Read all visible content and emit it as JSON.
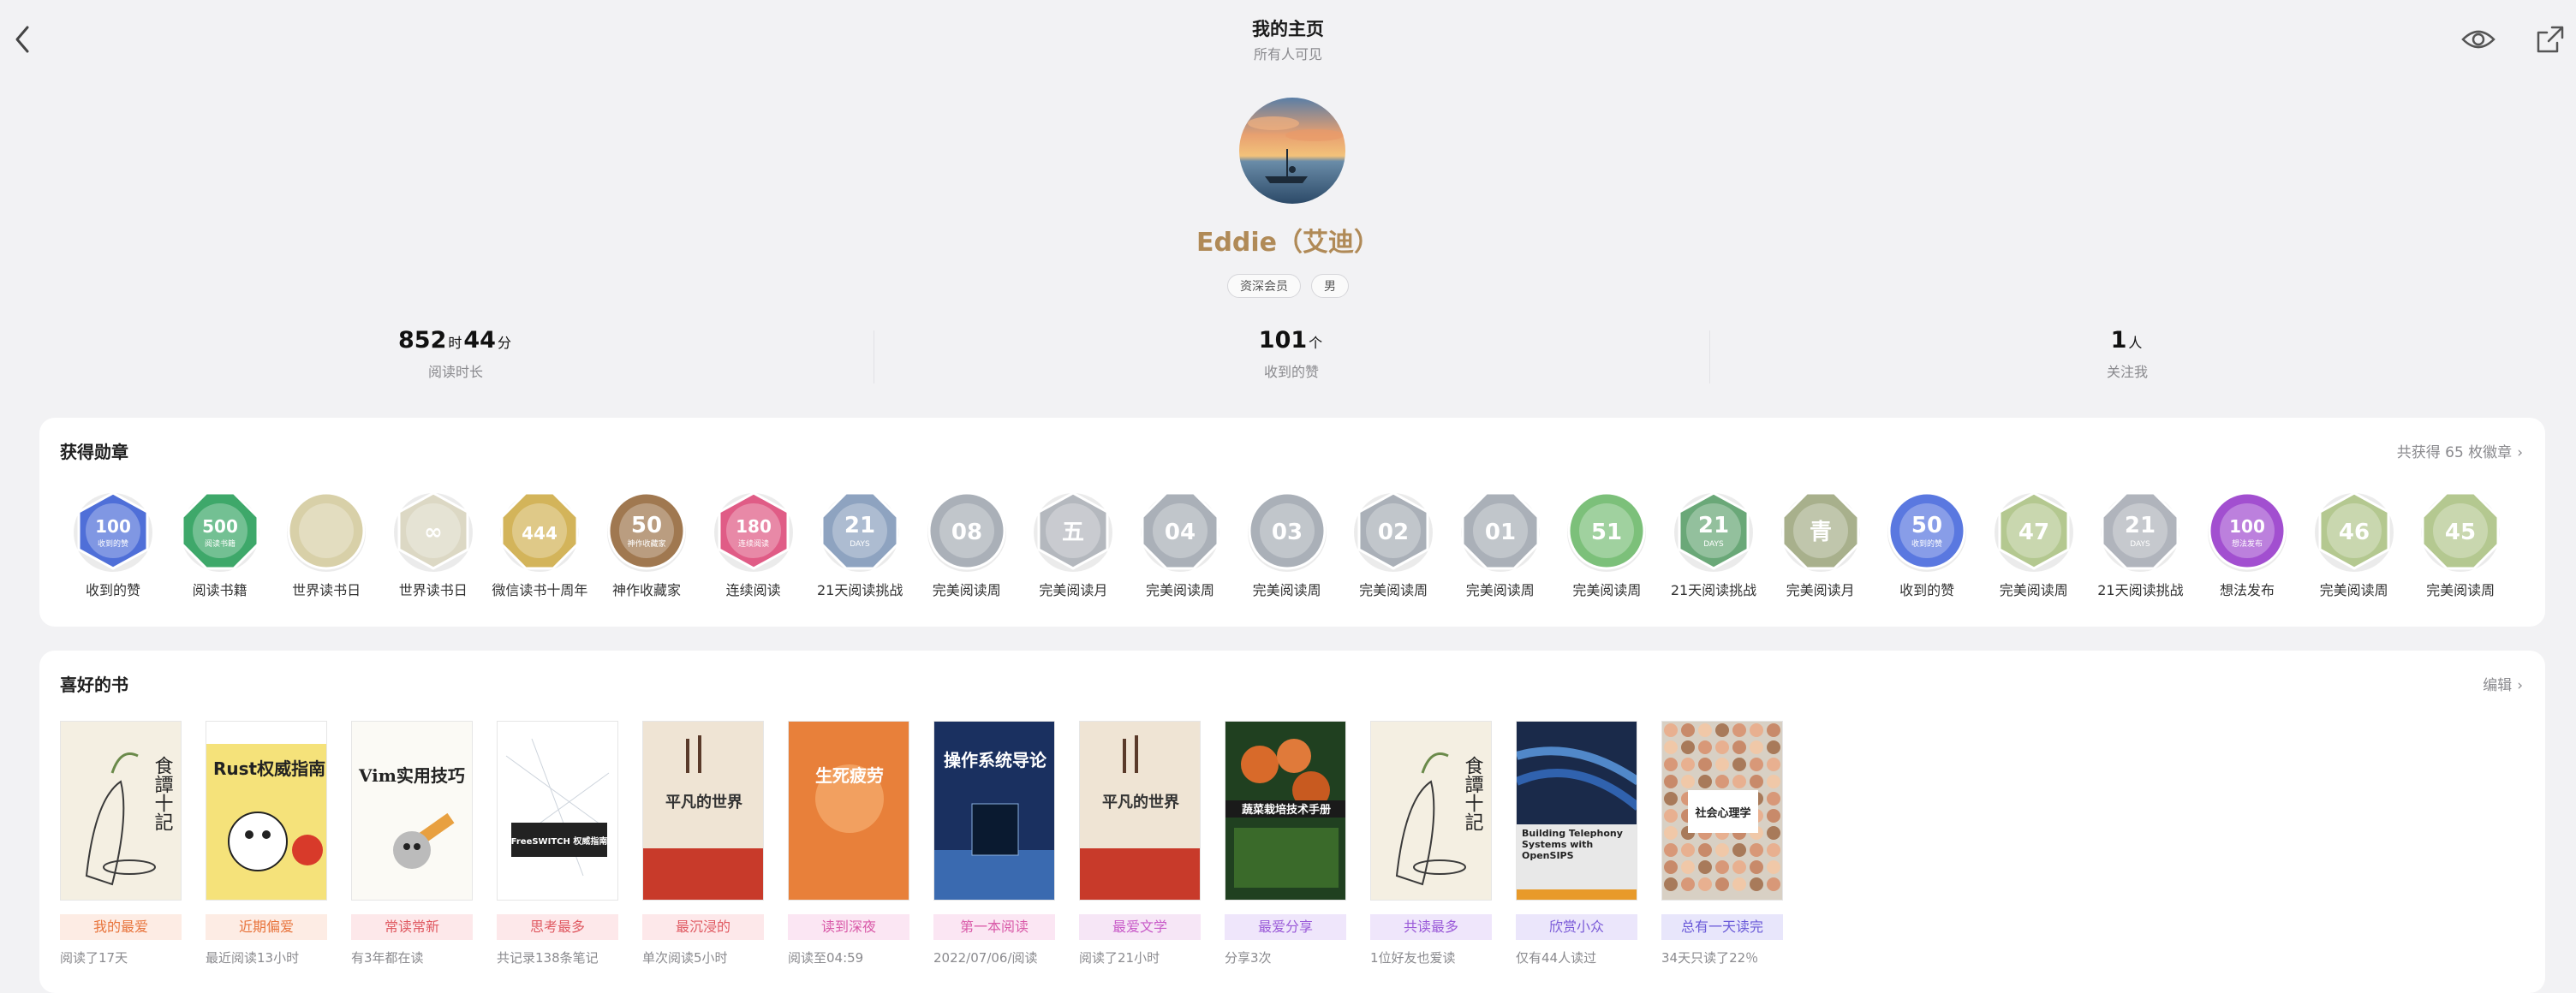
{
  "header": {
    "title": "我的主页",
    "subtitle": "所有人可见"
  },
  "profile": {
    "name": "Eddie（艾迪）",
    "tags": [
      "资深会员",
      "男"
    ]
  },
  "stats": {
    "reading_hours": "852",
    "hours_unit": "时",
    "reading_minutes": "44",
    "minutes_unit": "分",
    "reading_label": "阅读时长",
    "likes": "101",
    "likes_unit": "个",
    "likes_label": "收到的赞",
    "followers": "1",
    "followers_unit": "人",
    "followers_label": "关注我"
  },
  "badges_section": {
    "title": "获得勋章",
    "total_link": "共获得 65 枚徽章",
    "items": [
      {
        "label": "收到的赞",
        "mark": "100",
        "sub": "收到的赞",
        "color": "#4f6fd8"
      },
      {
        "label": "阅读书籍",
        "mark": "500",
        "sub": "阅读书籍",
        "color": "#3ea86a"
      },
      {
        "label": "世界读书日",
        "mark": "",
        "sub": "",
        "color": "#d8d0a8"
      },
      {
        "label": "世界读书日",
        "mark": "∞",
        "sub": "",
        "color": "#dcd8c4"
      },
      {
        "label": "微信读书十周年",
        "mark": "444",
        "sub": "",
        "color": "#d3b45a"
      },
      {
        "label": "神作收藏家",
        "mark": "50",
        "sub": "神作收藏家",
        "color": "#a07850"
      },
      {
        "label": "连续阅读",
        "mark": "180",
        "sub": "连续阅读",
        "color": "#e05c86"
      },
      {
        "label": "21天阅读挑战",
        "mark": "21",
        "sub": "DAYS",
        "color": "#8ea3c0"
      },
      {
        "label": "完美阅读周",
        "mark": "08",
        "sub": "",
        "color": "#aab0b8"
      },
      {
        "label": "完美阅读月",
        "mark": "五",
        "sub": "",
        "color": "#b4b8be"
      },
      {
        "label": "完美阅读周",
        "mark": "04",
        "sub": "",
        "color": "#aab0b8"
      },
      {
        "label": "完美阅读周",
        "mark": "03",
        "sub": "",
        "color": "#aab0b8"
      },
      {
        "label": "完美阅读周",
        "mark": "02",
        "sub": "",
        "color": "#aab0b8"
      },
      {
        "label": "完美阅读周",
        "mark": "01",
        "sub": "",
        "color": "#aab0b8"
      },
      {
        "label": "完美阅读周",
        "mark": "51",
        "sub": "",
        "color": "#7cc07a"
      },
      {
        "label": "21天阅读挑战",
        "mark": "21",
        "sub": "DAYS",
        "color": "#6aa878"
      },
      {
        "label": "完美阅读月",
        "mark": "青",
        "sub": "",
        "color": "#a8b08c"
      },
      {
        "label": "收到的赞",
        "mark": "50",
        "sub": "收到的赞",
        "color": "#5a78e0"
      },
      {
        "label": "完美阅读周",
        "mark": "47",
        "sub": "",
        "color": "#b4c890"
      },
      {
        "label": "21天阅读挑战",
        "mark": "21",
        "sub": "DAYS",
        "color": "#b0b4bc"
      },
      {
        "label": "想法发布",
        "mark": "100",
        "sub": "想法发布",
        "color": "#a24fd0"
      },
      {
        "label": "完美阅读周",
        "mark": "46",
        "sub": "",
        "color": "#b4c890"
      },
      {
        "label": "完美阅读周",
        "mark": "45",
        "sub": "",
        "color": "#b4c890"
      }
    ]
  },
  "books_section": {
    "title": "喜好的书",
    "edit_link": "编辑",
    "items": [
      {
        "chip": "我的最爱",
        "note": "阅读了17天",
        "chip_color": "#e8743c",
        "chip_bg": "#fdece4",
        "cover": "bijiji",
        "cover_title": "食譚十記"
      },
      {
        "chip": "近期偏爱",
        "note": "最近阅读13小时",
        "chip_color": "#e8743c",
        "chip_bg": "#fdece4",
        "cover": "rust",
        "cover_title": "Rust权威指南"
      },
      {
        "chip": "常读常新",
        "note": "有3年都在读",
        "chip_color": "#e05a62",
        "chip_bg": "#fde8ea",
        "cover": "vim",
        "cover_title": "Vim实用技巧"
      },
      {
        "chip": "思考最多",
        "note": "共记录138条笔记",
        "chip_color": "#e05a62",
        "chip_bg": "#fde8ea",
        "cover": "freeswitch",
        "cover_title": "FreeSWITCH 权威指南"
      },
      {
        "chip": "最沉浸的",
        "note": "单次阅读5小时",
        "chip_color": "#e05a62",
        "chip_bg": "#fde8ea",
        "cover": "pingfan",
        "cover_title": "平凡的世界"
      },
      {
        "chip": "读到深夜",
        "note": "阅读至04:59",
        "chip_color": "#d95aa8",
        "chip_bg": "#fbe6f3",
        "cover": "shengsi",
        "cover_title": "生死疲劳"
      },
      {
        "chip": "第一本阅读",
        "note": "2022/07/06/阅读",
        "chip_color": "#d95aa8",
        "chip_bg": "#fbe6f3",
        "cover": "os",
        "cover_title": "操作系统导论"
      },
      {
        "chip": "最爱文学",
        "note": "阅读了21小时",
        "chip_color": "#c85ac8",
        "chip_bg": "#f6e6f6",
        "cover": "pingfan",
        "cover_title": "平凡的世界"
      },
      {
        "chip": "最爱分享",
        "note": "分享3次",
        "chip_color": "#9a5ad8",
        "chip_bg": "#efe6fb",
        "cover": "veg",
        "cover_title": "蔬菜栽培技术手册"
      },
      {
        "chip": "共读最多",
        "note": "1位好友也爱读",
        "chip_color": "#9a5ad8",
        "chip_bg": "#efe6fb",
        "cover": "bijiji",
        "cover_title": "食譚十記"
      },
      {
        "chip": "欣赏小众",
        "note": "仅有44人读过",
        "chip_color": "#7a5ad8",
        "chip_bg": "#ebe6fb",
        "cover": "telephony",
        "cover_title": "Building Telephony Systems with OpenSIPS"
      },
      {
        "chip": "总有一天读完",
        "note": "34天只读了22％",
        "chip_color": "#6a5ad8",
        "chip_bg": "#e8e6fb",
        "cover": "social",
        "cover_title": "社会心理学"
      }
    ]
  }
}
